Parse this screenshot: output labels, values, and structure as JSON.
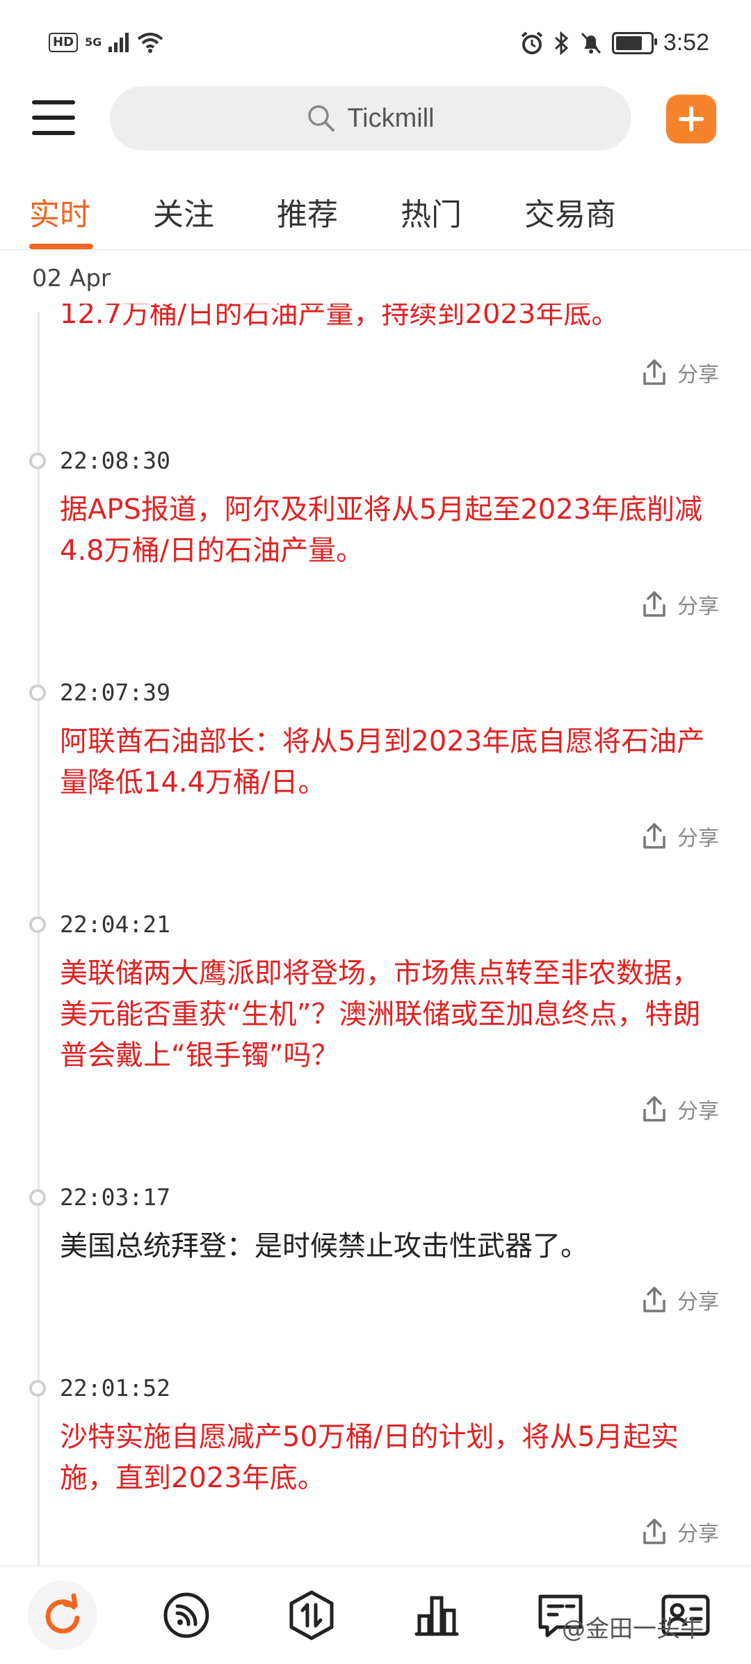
{
  "status_bar": {
    "hd": "HD",
    "signal_label": "5G",
    "time": "3:52",
    "battery_level": 0.85
  },
  "header": {
    "search_placeholder": "Tickmill"
  },
  "tabs": [
    {
      "label": "实时",
      "active": true
    },
    {
      "label": "关注",
      "active": false
    },
    {
      "label": "推荐",
      "active": false
    },
    {
      "label": "热门",
      "active": false
    },
    {
      "label": "交易商",
      "active": false
    }
  ],
  "feed": {
    "date": "02 Apr",
    "partial_item": {
      "text": "12.7万桶/日的石油产量，持续到2023年底。",
      "share_label": "分享"
    },
    "items": [
      {
        "time": "22:08:30",
        "text": "据APS报道，阿尔及利亚将从5月起至2023年底削减4.8万桶/日的石油产量。",
        "share_label": "分享",
        "color": "#e02222"
      },
      {
        "time": "22:07:39",
        "text": "阿联酋石油部长：将从5月到2023年底自愿将石油产量降低14.4万桶/日。",
        "share_label": "分享",
        "color": "#e02222"
      },
      {
        "time": "22:04:21",
        "text": "美联储两大鹰派即将登场，市场焦点转至非农数据，美元能否重获“生机”？澳洲联储或至加息终点，特朗普会戴上“银手镯”吗？",
        "share_label": "分享",
        "color": "#e02222"
      },
      {
        "time": "22:03:17",
        "text": "美国总统拜登：是时候禁止攻击性武器了。",
        "share_label": "分享",
        "color": "#222222"
      },
      {
        "time": "22:01:52",
        "text": "沙特实施自愿减产50万桶/日的计划，将从5月起实施，直到2023年底。",
        "share_label": "分享",
        "color": "#e02222"
      }
    ]
  },
  "bottom_nav": {
    "items": [
      "refresh-icon",
      "rss-icon",
      "exchange-icon",
      "chart-icon",
      "news-icon",
      "profile-card-icon"
    ],
    "watermark": "@金田一头牛"
  },
  "colors": {
    "accent": "#f26522",
    "add_button": "#f6832b",
    "news_red": "#e02222"
  }
}
